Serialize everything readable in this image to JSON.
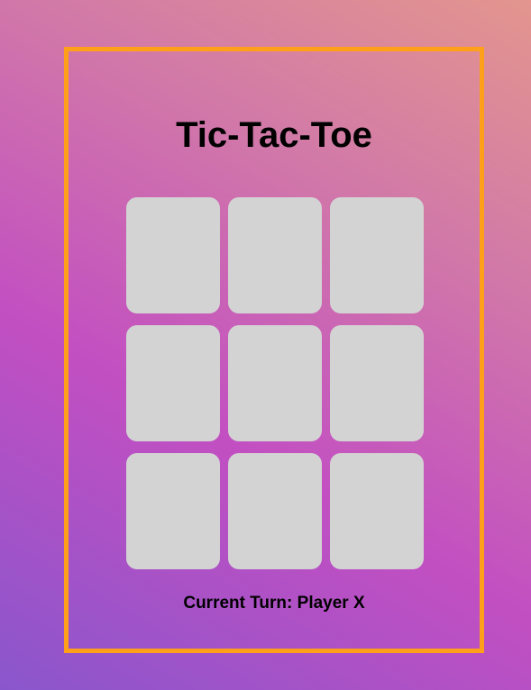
{
  "game": {
    "title": "Tic-Tac-Toe",
    "status": "Current Turn: Player X",
    "board": [
      "",
      "",
      "",
      "",
      "",
      "",
      "",
      "",
      ""
    ]
  },
  "colors": {
    "frame_border": "#ff9f1a",
    "cell_background": "#d3d3d3",
    "background_gradient": [
      "#8a56cc",
      "#c24fc2",
      "#d27aa7",
      "#e3958e"
    ]
  }
}
